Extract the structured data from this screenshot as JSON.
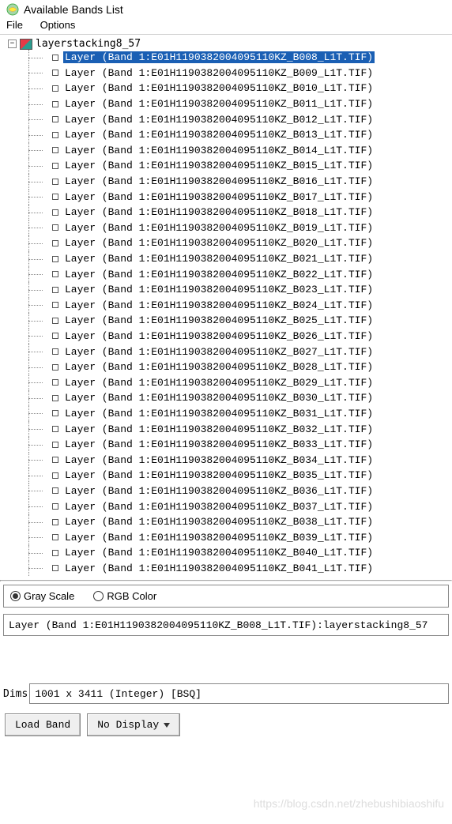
{
  "window": {
    "title": "Available Bands List"
  },
  "menu": {
    "file": "File",
    "options": "Options"
  },
  "tree": {
    "root_label": "layerstacking8_57",
    "selected_index": 0,
    "layers": [
      "Layer (Band 1:E01H1190382004095110KZ_B008_L1T.TIF)",
      "Layer (Band 1:E01H1190382004095110KZ_B009_L1T.TIF)",
      "Layer (Band 1:E01H1190382004095110KZ_B010_L1T.TIF)",
      "Layer (Band 1:E01H1190382004095110KZ_B011_L1T.TIF)",
      "Layer (Band 1:E01H1190382004095110KZ_B012_L1T.TIF)",
      "Layer (Band 1:E01H1190382004095110KZ_B013_L1T.TIF)",
      "Layer (Band 1:E01H1190382004095110KZ_B014_L1T.TIF)",
      "Layer (Band 1:E01H1190382004095110KZ_B015_L1T.TIF)",
      "Layer (Band 1:E01H1190382004095110KZ_B016_L1T.TIF)",
      "Layer (Band 1:E01H1190382004095110KZ_B017_L1T.TIF)",
      "Layer (Band 1:E01H1190382004095110KZ_B018_L1T.TIF)",
      "Layer (Band 1:E01H1190382004095110KZ_B019_L1T.TIF)",
      "Layer (Band 1:E01H1190382004095110KZ_B020_L1T.TIF)",
      "Layer (Band 1:E01H1190382004095110KZ_B021_L1T.TIF)",
      "Layer (Band 1:E01H1190382004095110KZ_B022_L1T.TIF)",
      "Layer (Band 1:E01H1190382004095110KZ_B023_L1T.TIF)",
      "Layer (Band 1:E01H1190382004095110KZ_B024_L1T.TIF)",
      "Layer (Band 1:E01H1190382004095110KZ_B025_L1T.TIF)",
      "Layer (Band 1:E01H1190382004095110KZ_B026_L1T.TIF)",
      "Layer (Band 1:E01H1190382004095110KZ_B027_L1T.TIF)",
      "Layer (Band 1:E01H1190382004095110KZ_B028_L1T.TIF)",
      "Layer (Band 1:E01H1190382004095110KZ_B029_L1T.TIF)",
      "Layer (Band 1:E01H1190382004095110KZ_B030_L1T.TIF)",
      "Layer (Band 1:E01H1190382004095110KZ_B031_L1T.TIF)",
      "Layer (Band 1:E01H1190382004095110KZ_B032_L1T.TIF)",
      "Layer (Band 1:E01H1190382004095110KZ_B033_L1T.TIF)",
      "Layer (Band 1:E01H1190382004095110KZ_B034_L1T.TIF)",
      "Layer (Band 1:E01H1190382004095110KZ_B035_L1T.TIF)",
      "Layer (Band 1:E01H1190382004095110KZ_B036_L1T.TIF)",
      "Layer (Band 1:E01H1190382004095110KZ_B037_L1T.TIF)",
      "Layer (Band 1:E01H1190382004095110KZ_B038_L1T.TIF)",
      "Layer (Band 1:E01H1190382004095110KZ_B039_L1T.TIF)",
      "Layer (Band 1:E01H1190382004095110KZ_B040_L1T.TIF)",
      "Layer (Band 1:E01H1190382004095110KZ_B041_L1T.TIF)"
    ]
  },
  "display_mode": {
    "gray_label": "Gray Scale",
    "rgb_label": "RGB Color",
    "selected": "gray"
  },
  "selected_layer_info": "Layer (Band 1:E01H1190382004095110KZ_B008_L1T.TIF):layerstacking8_57",
  "dims": {
    "label": "Dims",
    "value": "1001 x 3411 (Integer) [BSQ]"
  },
  "buttons": {
    "load_band": "Load Band",
    "no_display": "No Display"
  },
  "watermark": "https://blog.csdn.net/zhebushibiaoshifu"
}
